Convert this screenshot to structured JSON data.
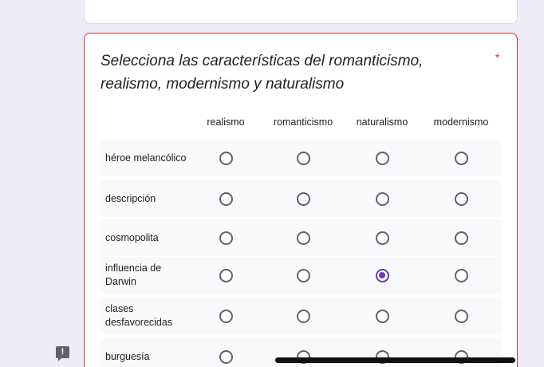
{
  "question": {
    "title": "Selecciona las características del romanticismo, realismo, modernismo y naturalismo",
    "required_mark": "*"
  },
  "columns": [
    "realismo",
    "romanticismo",
    "naturalismo",
    "modernismo"
  ],
  "rows": [
    {
      "label": "héroe melancólico",
      "selected": null
    },
    {
      "label": "descripción",
      "selected": null
    },
    {
      "label": "cosmopolita",
      "selected": null
    },
    {
      "label": "influencia de Darwin",
      "selected": "naturalismo"
    },
    {
      "label": "clases desfavorecidas",
      "selected": null
    },
    {
      "label": "burguesía",
      "selected": null
    }
  ],
  "colors": {
    "accent": "#673ab7",
    "error": "#d93025",
    "background": "#efebf8"
  },
  "icons": {
    "report": "report-problem-icon"
  }
}
